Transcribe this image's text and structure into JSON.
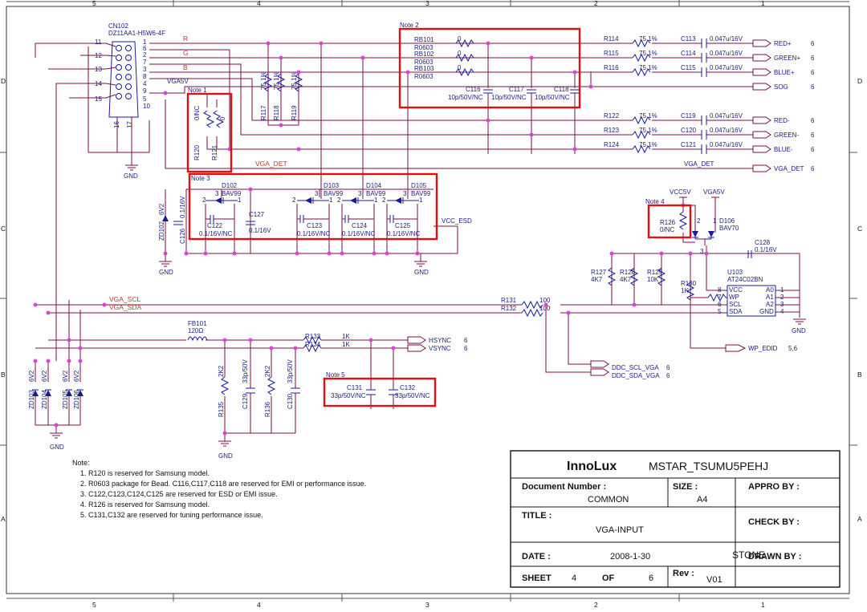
{
  "frame": {
    "col_labels": [
      "5",
      "4",
      "3",
      "2",
      "1"
    ],
    "row_labels": [
      "D",
      "C",
      "B",
      "A"
    ]
  },
  "connector": {
    "ref": "CN102",
    "part": "DZ11AA1-H5W6-4F",
    "pins_left": [
      "11",
      "12",
      "13",
      "14",
      "15"
    ],
    "pins_right": [
      "1",
      "6",
      "2",
      "7",
      "3",
      "8",
      "4",
      "9",
      "5",
      "10"
    ],
    "pins_bottom": [
      "16",
      "17"
    ]
  },
  "nets": {
    "r": "R",
    "g": "G",
    "b": "B",
    "vga5v": "VGA5V",
    "vga_det": "VGA_DET",
    "vga_scl": "VGA_SCL",
    "vga_sda": "VGA_SDA",
    "vcc5v": "VCC5V",
    "vga5v2": "VGA5V",
    "vcc_esd": "VCC_ESD",
    "vga_det2": "VGA_DET"
  },
  "notes_tags": [
    "Note 1",
    "Note 2",
    "Note 3",
    "Note 4",
    "Note 5"
  ],
  "ports": [
    {
      "label": "RED+",
      "sheet": "6"
    },
    {
      "label": "GREEN+",
      "sheet": "6"
    },
    {
      "label": "BLUE+",
      "sheet": "6"
    },
    {
      "label": "SOG",
      "sheet": "6"
    },
    {
      "label": "RED-",
      "sheet": "6"
    },
    {
      "label": "GREEN-",
      "sheet": "6"
    },
    {
      "label": "BLUE-",
      "sheet": "6"
    },
    {
      "label": "VGA_DET",
      "sheet": "6"
    },
    {
      "label": "HSYNC",
      "sheet": "6"
    },
    {
      "label": "VSYNC",
      "sheet": "6"
    },
    {
      "label": "DDC_SCL_VGA",
      "sheet": "6"
    },
    {
      "label": "DDC_SDA_VGA",
      "sheet": "6"
    },
    {
      "label": "WP_EDID",
      "sheet": "5,6"
    }
  ],
  "rb": [
    {
      "ref": "RB101",
      "pkg": "R0603",
      "val": "0"
    },
    {
      "ref": "RB102",
      "pkg": "R0603",
      "val": "0"
    },
    {
      "ref": "RB103",
      "pkg": "R0603",
      "val": "0"
    }
  ],
  "series_r": [
    {
      "ref": "R114",
      "val": "75 1%"
    },
    {
      "ref": "R115",
      "val": "75 1%"
    },
    {
      "ref": "R116",
      "val": "75 1%"
    },
    {
      "ref": "R122",
      "val": "75 1%"
    },
    {
      "ref": "R123",
      "val": "75 1%"
    },
    {
      "ref": "R124",
      "val": "75 1%"
    }
  ],
  "series_c": [
    {
      "ref": "C113",
      "val": "0.047u/16V"
    },
    {
      "ref": "C114",
      "val": "0.047u/16V"
    },
    {
      "ref": "C115",
      "val": "0.047u/16V"
    },
    {
      "ref": "C119",
      "val": "0.047u/16V"
    },
    {
      "ref": "C120",
      "val": "0.047u/16V"
    },
    {
      "ref": "C121",
      "val": "0.047u/16V"
    }
  ],
  "filter_c": [
    {
      "ref": "C116",
      "val": "10p/50V/NC"
    },
    {
      "ref": "C117",
      "val": "10p/50V/NC"
    },
    {
      "ref": "C118",
      "val": "10p/50V/NC"
    }
  ],
  "term_r": [
    {
      "ref": "R117",
      "val": "75 1%"
    },
    {
      "ref": "R118",
      "val": "75 1%"
    },
    {
      "ref": "R119",
      "val": "75 1%"
    }
  ],
  "note1_r": [
    {
      "ref": "R120",
      "val": "0/NC"
    },
    {
      "ref": "R121",
      "val": "0"
    }
  ],
  "diodes": [
    {
      "ref": "D102",
      "part": "BAV99"
    },
    {
      "ref": "D103",
      "part": "BAV99"
    },
    {
      "ref": "D104",
      "part": "BAV99"
    },
    {
      "ref": "D105",
      "part": "BAV99"
    },
    {
      "ref": "D106",
      "part": "BAV70"
    }
  ],
  "esd_c": [
    {
      "ref": "C122",
      "val": "0.1/16V/NC"
    },
    {
      "ref": "C123",
      "val": "0.1/16V/NC"
    },
    {
      "ref": "C124",
      "val": "0.1/16V/NC"
    },
    {
      "ref": "C125",
      "val": "0.1/16V/NC"
    },
    {
      "ref": "C127",
      "val": "0.1/16V"
    },
    {
      "ref": "C126",
      "val": "0.1/16V"
    },
    {
      "ref": "C128",
      "val": "0.1/16V"
    }
  ],
  "zeners": [
    {
      "ref": "ZD102",
      "val": "6V2"
    },
    {
      "ref": "ZD103",
      "val": "6V2"
    },
    {
      "ref": "ZD104",
      "val": "6V2"
    },
    {
      "ref": "ZD105",
      "val": "6V2"
    },
    {
      "ref": "ZD106",
      "val": "6V2"
    }
  ],
  "eeprom": {
    "ref": "U103",
    "part": "AT24C02BN",
    "pins_left": [
      "VCC",
      "WP",
      "SCL",
      "SDA"
    ],
    "nums_left": [
      "8",
      "7",
      "6",
      "5"
    ],
    "pins_right": [
      "A0",
      "A1",
      "A2",
      "GND"
    ],
    "nums_right": [
      "1",
      "2",
      "3",
      "4"
    ]
  },
  "pullups": [
    {
      "ref": "R127",
      "val": "4K7"
    },
    {
      "ref": "R128",
      "val": "4K7"
    },
    {
      "ref": "R129",
      "val": "10K"
    },
    {
      "ref": "R130",
      "val": "1K"
    }
  ],
  "r126": {
    "ref": "R126",
    "val": "0/NC"
  },
  "i2c_r": [
    {
      "ref": "R131",
      "val": "100"
    },
    {
      "ref": "R132",
      "val": "100"
    }
  ],
  "sync_r": [
    {
      "ref": "R133",
      "val": "1K"
    },
    {
      "ref": "R134",
      "val": "1K"
    }
  ],
  "bead": {
    "ref": "FB101",
    "val": "120Ω"
  },
  "sync_parts": [
    {
      "ref": "R135",
      "val": "2K2"
    },
    {
      "ref": "C129",
      "val": "33p/50V"
    },
    {
      "ref": "R136",
      "val": "2K2"
    },
    {
      "ref": "C130",
      "val": "33p/50V"
    }
  ],
  "note5_c": [
    {
      "ref": "C131",
      "val": "33p/50V/NC"
    },
    {
      "ref": "C132",
      "val": "33p/50V/NC"
    }
  ],
  "gnd": "GND",
  "diode_pins": {
    "p1": "1",
    "p2": "2",
    "p3": "3"
  },
  "notes": {
    "title": "Note:",
    "lines": [
      "1. R120 is reserved for Samsung model.",
      "2. R0603 package for Bead. C116,C117,C118 are reserved for EMI or performance issue.",
      "3. C122,C123,C124,C125 are reserved for ESD or EMI  issue.",
      "4. R126 is reserved for Samsung model.",
      "5. C131,C132 are reserved for tuning performance issue."
    ]
  },
  "titleblock": {
    "company": "InnoLux",
    "project": "MSTAR_TSUMU5PEHJ",
    "doc_label": "Document Number :",
    "doc_value": "COMMON",
    "size_label": "SIZE :",
    "size_value": "A4",
    "appro_label": "APPRO BY :",
    "title_label": "TITLE :",
    "title_value": "VGA-INPUT",
    "check_label": "CHECK BY :",
    "date_label": "DATE :",
    "date_value": "2008-1-30",
    "stamp": "STONE",
    "drawn_label": "DRAWN BY :",
    "sheet_label": "SHEET",
    "sheet_value": "4",
    "of_label": "OF",
    "of_value": "6",
    "rev_label": "Rev :",
    "rev_value": "V01"
  }
}
